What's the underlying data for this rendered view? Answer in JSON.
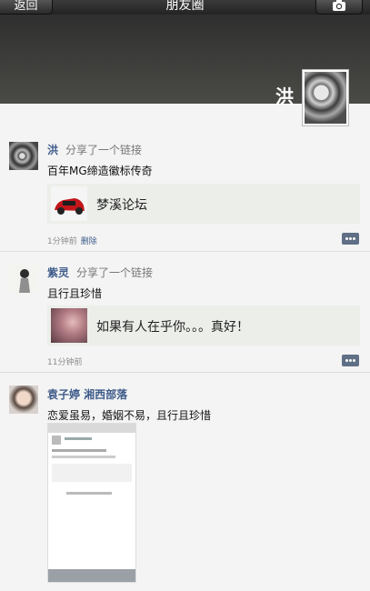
{
  "header": {
    "back_label": "返回",
    "title": "朋友圈"
  },
  "owner": {
    "name": "洪"
  },
  "posts": [
    {
      "name": "洪",
      "action": "分享了一个链接",
      "text": "百年MG缔造徽标传奇",
      "link_title": "梦溪论坛",
      "time": "1分钟前",
      "delete_label": "删除"
    },
    {
      "name": "紫灵",
      "action": "分享了一个链接",
      "text": "且行且珍惜",
      "link_title": "如果有人在乎你。。。真好！",
      "time": "11分钟前"
    },
    {
      "name": "袁子婷 湘西部落",
      "text": "恋爱虽易，婚姻不易，且行且珍惜"
    }
  ],
  "icons": [
    "camera-icon",
    "comment-icon"
  ],
  "colors": {
    "name": "#3e5b8a",
    "topbar": "#2a2a2a"
  }
}
